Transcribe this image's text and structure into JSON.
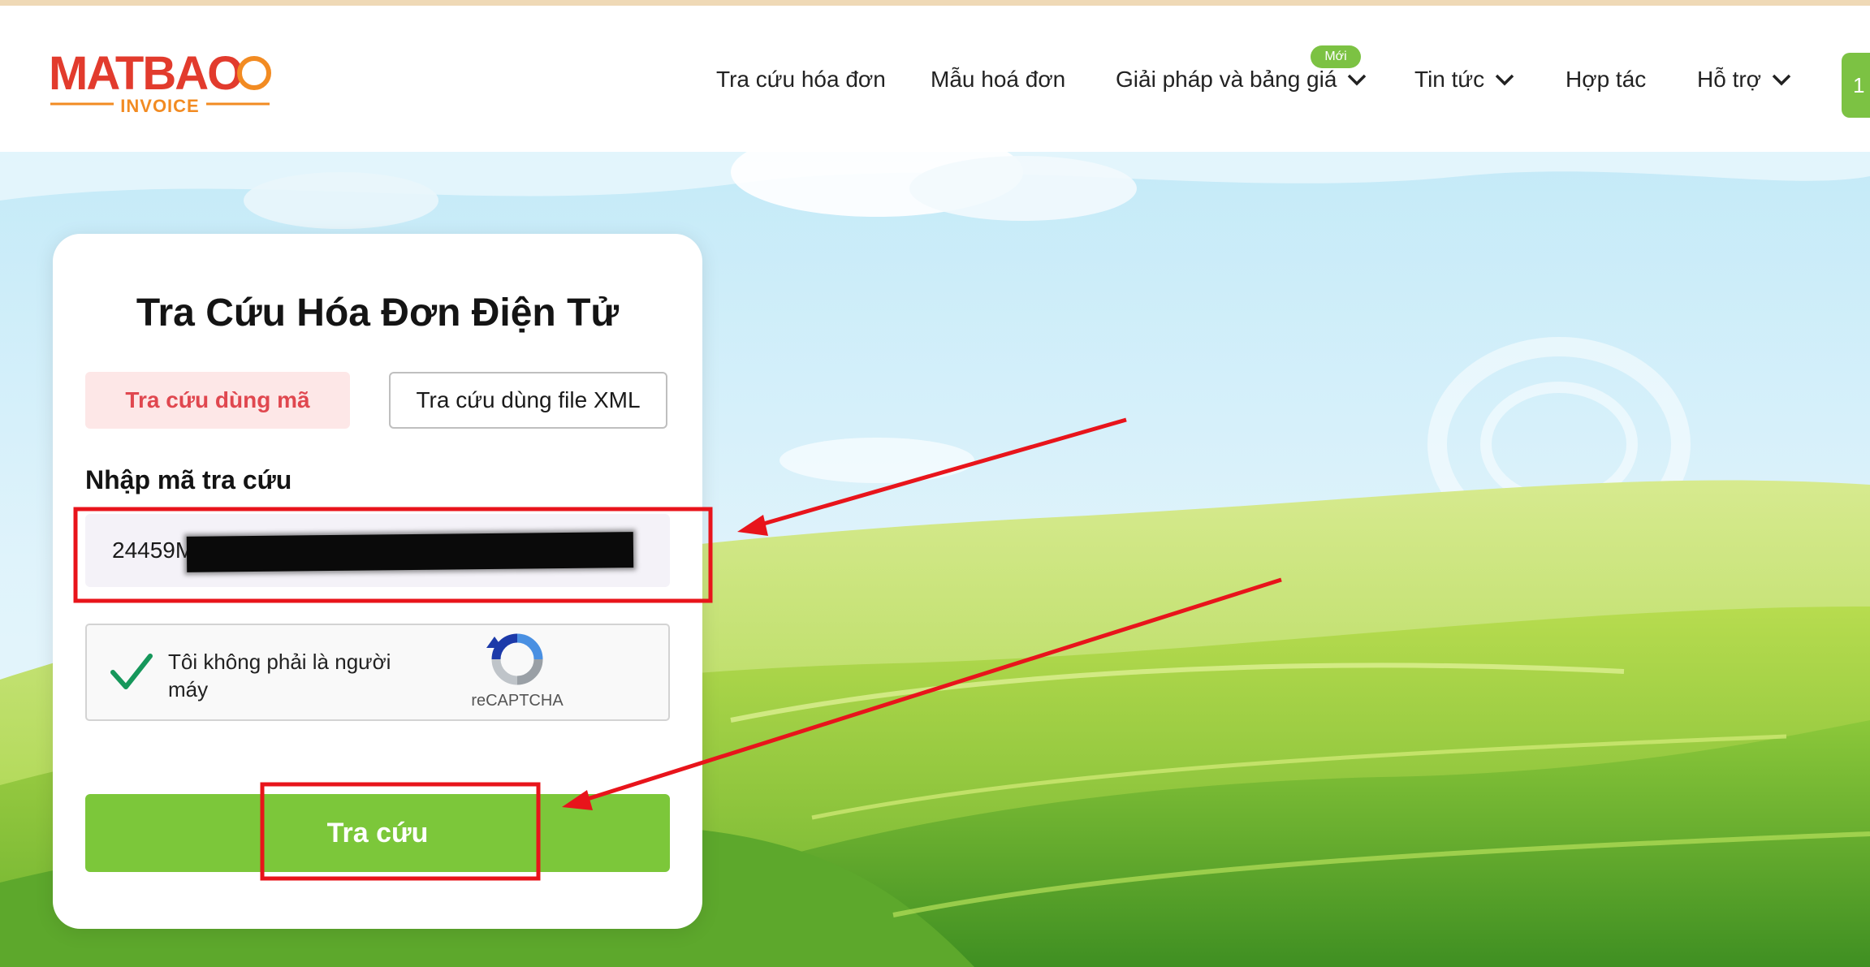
{
  "brand": {
    "logo_word": "MATBAO",
    "logo_sub": "INVOICE",
    "brand_red": "#e23b2d",
    "brand_orange": "#f28b22",
    "brand_green": "#7cc243"
  },
  "nav": {
    "items": [
      {
        "label": "Tra cứu hóa đơn",
        "has_dropdown": false
      },
      {
        "label": "Mẫu hoá đơn",
        "has_dropdown": false
      },
      {
        "label": "Giải pháp và bảng giá",
        "has_dropdown": true,
        "badge": "Mới"
      },
      {
        "label": "Tin tức",
        "has_dropdown": true
      },
      {
        "label": "Hợp tác",
        "has_dropdown": false
      },
      {
        "label": "Hỗ trợ",
        "has_dropdown": true
      }
    ],
    "cta_partial": "1"
  },
  "form": {
    "title": "Tra Cứu Hóa Đơn Điện Tử",
    "tabs": [
      {
        "label": "Tra cứu dùng mã",
        "active": true
      },
      {
        "label": "Tra cứu dùng file XML",
        "active": false
      }
    ],
    "input_label": "Nhập mã tra cứu",
    "input_value": "24459M03",
    "captcha": {
      "text": "Tôi không phải là người máy",
      "brand": "reCAPTCHA",
      "checked": true
    },
    "submit_label": "Tra cứu"
  },
  "annotations": {
    "color": "#e8141b",
    "highlighted": [
      "lookup-code-input",
      "search-submit-button"
    ]
  }
}
